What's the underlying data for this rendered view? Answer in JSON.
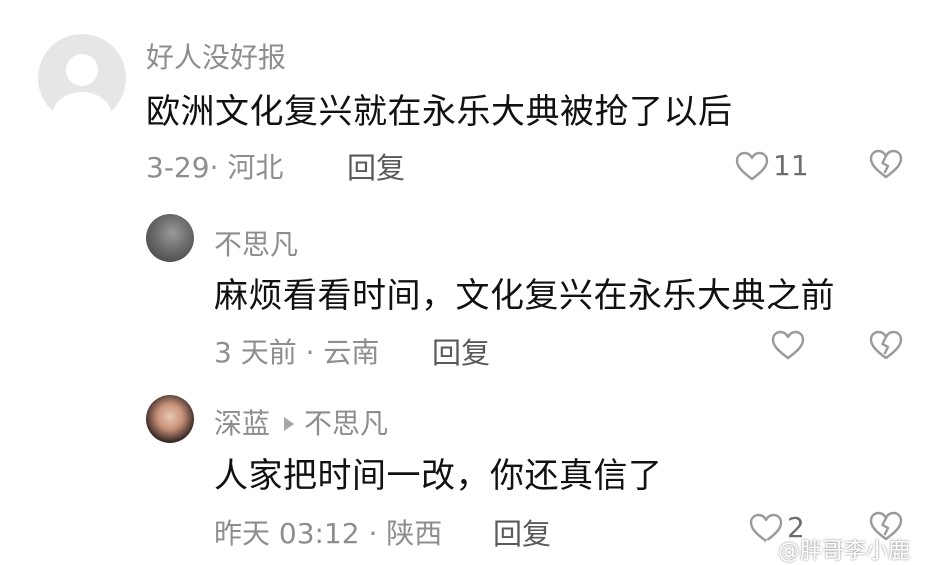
{
  "comments": [
    {
      "username": "好人没好报",
      "text": "欧洲文化复兴就在永乐大典被抢了以后",
      "meta": "3-29· 河北",
      "reply_label": "回复",
      "likes": "11"
    },
    {
      "username": "不思凡",
      "text": "麻烦看看时间，文化复兴在永乐大典之前",
      "meta": "3 天前 · 云南",
      "reply_label": "回复",
      "likes": ""
    },
    {
      "username": "深蓝",
      "reply_to": "不思凡",
      "text": "人家把时间一改，你还真信了",
      "meta": "昨天 03:12 · 陕西",
      "reply_label": "回复",
      "likes": "2"
    }
  ],
  "watermark": "@胖哥李小鹿"
}
